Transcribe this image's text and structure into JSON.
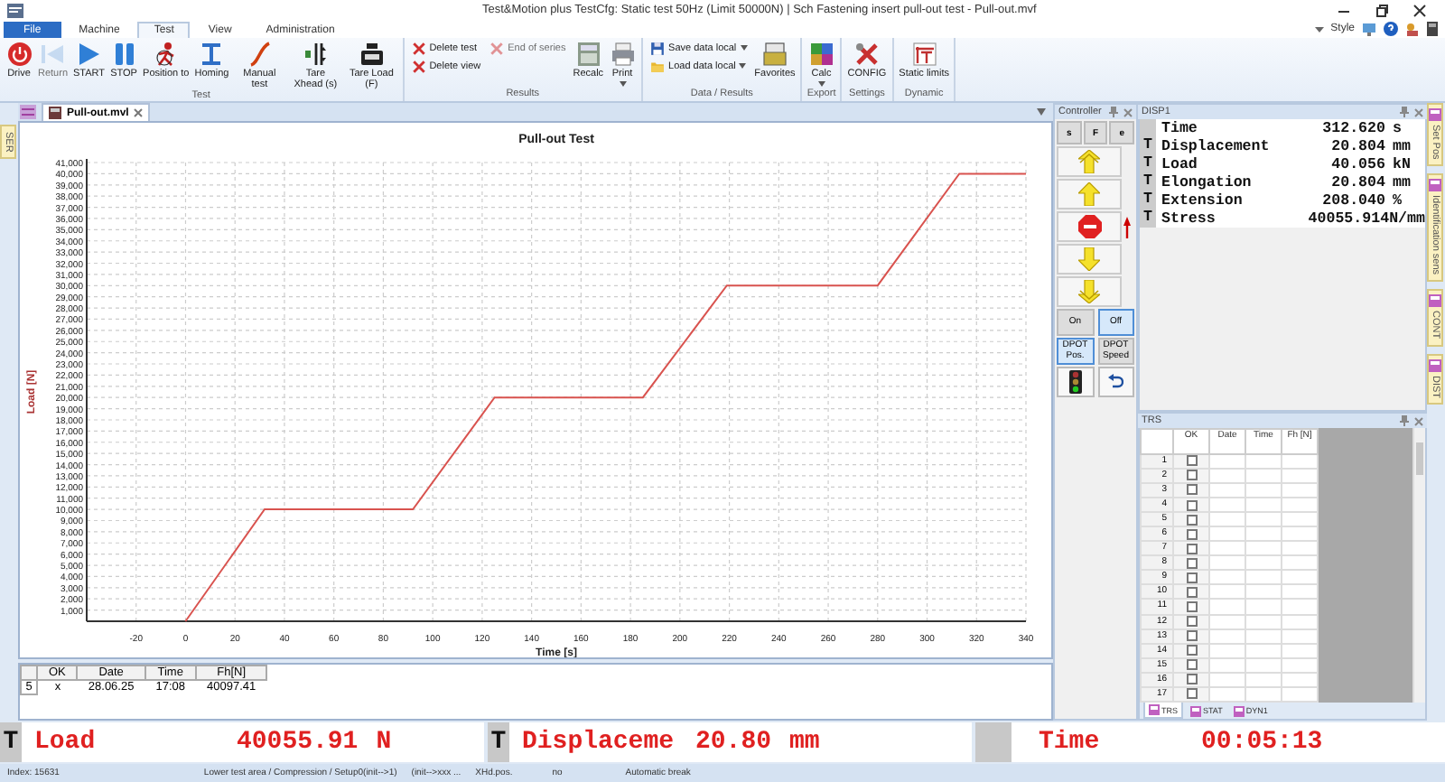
{
  "window": {
    "title": "Test&Motion plus   TestCfg: Static test 50Hz (Limit 50000N) | Sch Fastening insert pull-out test  - Pull-out.mvf"
  },
  "menu_tabs": [
    {
      "label": "File",
      "kind": "file",
      "selected": false
    },
    {
      "label": "Machine",
      "kind": "tab",
      "selected": false
    },
    {
      "label": "Test",
      "kind": "tab",
      "selected": true
    },
    {
      "label": "View",
      "kind": "tab",
      "selected": false
    },
    {
      "label": "Administration",
      "kind": "tab",
      "selected": false
    }
  ],
  "quick_access": {
    "style": "Style"
  },
  "ribbon": {
    "groups": [
      {
        "label": "Test",
        "items": [
          {
            "label": "Drive",
            "kind": "large",
            "disabled": false
          },
          {
            "label": "Return",
            "kind": "large",
            "disabled": true
          },
          {
            "label": "START",
            "kind": "large",
            "disabled": false
          },
          {
            "label": "STOP",
            "kind": "large",
            "disabled": false
          },
          {
            "label": "Position to",
            "kind": "large",
            "disabled": false
          },
          {
            "label": "Homing",
            "kind": "large",
            "disabled": false
          },
          {
            "label": "Manual test",
            "kind": "large",
            "disabled": false
          },
          {
            "label": "Tare Xhead (s)",
            "kind": "large",
            "disabled": false
          },
          {
            "label": "Tare Load (F)",
            "kind": "large",
            "disabled": false
          }
        ]
      },
      {
        "label": "Results",
        "items": [
          {
            "label": "Delete test",
            "kind": "small",
            "disabled": false
          },
          {
            "label": "Delete view",
            "kind": "small",
            "disabled": false
          },
          {
            "label": "End of series",
            "kind": "small",
            "disabled": true
          },
          {
            "label": "Recalc",
            "kind": "large",
            "disabled": false
          },
          {
            "label": "Print",
            "kind": "large",
            "disabled": false,
            "dropdown": true
          }
        ]
      },
      {
        "label": "Data / Results",
        "items": [
          {
            "label": "Save data local",
            "kind": "small",
            "disabled": false,
            "dropdown": true
          },
          {
            "label": "Load data local",
            "kind": "small",
            "disabled": false,
            "dropdown": true
          },
          {
            "label": "Favorites",
            "kind": "large",
            "disabled": false
          }
        ]
      },
      {
        "label": "Export",
        "items": [
          {
            "label": "Calc",
            "kind": "large",
            "disabled": false,
            "dropdown": true
          }
        ]
      },
      {
        "label": "Settings",
        "items": [
          {
            "label": "CONFIG",
            "kind": "large",
            "disabled": false
          }
        ]
      },
      {
        "label": "Dynamic",
        "items": [
          {
            "label": "Static limits",
            "kind": "large",
            "disabled": false
          }
        ]
      }
    ]
  },
  "doc_tabs": [
    {
      "label": "Pull-out.mvl",
      "selected": true
    }
  ],
  "left_side_tabs": [
    {
      "label": "SER"
    }
  ],
  "right_side_tabs": [
    {
      "label": "Set Pos"
    },
    {
      "label": "Identification sens"
    },
    {
      "label": "CONT"
    },
    {
      "label": "DIST"
    }
  ],
  "chart": {
    "chart_data": {
      "type": "line",
      "title": "Pull-out Test",
      "xlabel": "Time [s]",
      "ylabel": "Load [N]",
      "grid": true,
      "xlim": [
        -40,
        340
      ],
      "ylim": [
        0,
        41000
      ],
      "xticks": [
        -20,
        0,
        20,
        40,
        60,
        80,
        100,
        120,
        140,
        160,
        180,
        200,
        220,
        240,
        260,
        280,
        300,
        320,
        340
      ],
      "yticks": [
        {
          "value": 1000,
          "label": "1,000"
        },
        {
          "value": 2000,
          "label": "2,000"
        },
        {
          "value": 3000,
          "label": "3,000"
        },
        {
          "value": 4000,
          "label": "4,000"
        },
        {
          "value": 5000,
          "label": "5,000"
        },
        {
          "value": 6000,
          "label": "6,000"
        },
        {
          "value": 7000,
          "label": "7,000"
        },
        {
          "value": 8000,
          "label": "8,000"
        },
        {
          "value": 9000,
          "label": "9,000"
        },
        {
          "value": 10000,
          "label": "10,000"
        },
        {
          "value": 11000,
          "label": "11,000"
        },
        {
          "value": 12000,
          "label": "12,000"
        },
        {
          "value": 13000,
          "label": "13,000"
        },
        {
          "value": 14000,
          "label": "14,000"
        },
        {
          "value": 15000,
          "label": "15,000"
        },
        {
          "value": 16000,
          "label": "16,000"
        },
        {
          "value": 17000,
          "label": "17,000"
        },
        {
          "value": 18000,
          "label": "18,000"
        },
        {
          "value": 19000,
          "label": "19,000"
        },
        {
          "value": 20000,
          "label": "20,000"
        },
        {
          "value": 21000,
          "label": "21,000"
        },
        {
          "value": 22000,
          "label": "22,000"
        },
        {
          "value": 23000,
          "label": "23,000"
        },
        {
          "value": 24000,
          "label": "24,000"
        },
        {
          "value": 25000,
          "label": "25,000"
        },
        {
          "value": 26000,
          "label": "26,000"
        },
        {
          "value": 27000,
          "label": "27,000"
        },
        {
          "value": 28000,
          "label": "28,000"
        },
        {
          "value": 29000,
          "label": "29,000"
        },
        {
          "value": 30000,
          "label": "30,000"
        },
        {
          "value": 31000,
          "label": "31,000"
        },
        {
          "value": 32000,
          "label": "32,000"
        },
        {
          "value": 33000,
          "label": "33,000"
        },
        {
          "value": 34000,
          "label": "34,000"
        },
        {
          "value": 35000,
          "label": "35,000"
        },
        {
          "value": 36000,
          "label": "36,000"
        },
        {
          "value": 37000,
          "label": "37,000"
        },
        {
          "value": 38000,
          "label": "38,000"
        },
        {
          "value": 39000,
          "label": "39,000"
        },
        {
          "value": 40000,
          "label": "40,000"
        },
        {
          "value": 41000,
          "label": "41,000"
        }
      ],
      "x": [
        0,
        32,
        92,
        125,
        185,
        219,
        280,
        313,
        340
      ],
      "series": [
        {
          "color": "#d9534f",
          "values": [
            0,
            10000,
            10000,
            20000,
            20000,
            30000,
            30000,
            40000,
            40000
          ]
        }
      ]
    }
  },
  "results": {
    "columns": [
      "OK",
      "Date",
      "Time",
      "Fh[N]"
    ],
    "rows": [
      {
        "index": "5",
        "cells": [
          "x",
          "28.06.25",
          "17:08",
          "40097.41"
        ]
      }
    ]
  },
  "controller": {
    "title": "Controller",
    "modes": [
      "s",
      "F",
      "e"
    ],
    "jog": [
      {
        "kind": "fast-up"
      },
      {
        "kind": "up"
      },
      {
        "kind": "stop"
      },
      {
        "kind": "down"
      },
      {
        "kind": "fast-down"
      }
    ],
    "toggles": [
      {
        "label": "On",
        "selected": false
      },
      {
        "label": "Off",
        "selected": true
      }
    ],
    "dpot": [
      {
        "label": "DPOT Pos.",
        "selected": true
      },
      {
        "label": "DPOT Speed",
        "selected": false
      }
    ]
  },
  "disp1": {
    "title": "DISP1",
    "rows": [
      {
        "name": "Time",
        "value": "312.620",
        "unit": "s"
      },
      {
        "mark": "T",
        "name": "Displacement",
        "value": "20.804",
        "unit": "mm"
      },
      {
        "mark": "T",
        "name": "Load",
        "value": "40.056",
        "unit": "kN"
      },
      {
        "mark": "T",
        "name": "Elongation",
        "value": "20.804",
        "unit": "mm"
      },
      {
        "mark": "T",
        "name": "Extension",
        "value": "208.040",
        "unit": "%"
      },
      {
        "mark": "T",
        "name": "Stress",
        "value": "40055.914N/mm"
      }
    ]
  },
  "trs": {
    "title": "TRS",
    "columns": [
      "OK",
      "Date",
      "Time",
      "Fh [N]"
    ],
    "rows": [
      {
        "index": "1",
        "checked": false
      },
      {
        "index": "2",
        "checked": false
      },
      {
        "index": "3",
        "checked": false
      },
      {
        "index": "4",
        "checked": false
      },
      {
        "index": "5",
        "checked": false
      },
      {
        "index": "6",
        "checked": false
      },
      {
        "index": "7",
        "checked": false
      },
      {
        "index": "8",
        "checked": false
      },
      {
        "index": "9",
        "checked": false
      },
      {
        "index": "10",
        "checked": false
      },
      {
        "index": "11",
        "checked": false
      },
      {
        "index": "12",
        "checked": false
      },
      {
        "index": "13",
        "checked": false
      },
      {
        "index": "14",
        "checked": false
      },
      {
        "index": "15",
        "checked": false
      },
      {
        "index": "16",
        "checked": false
      },
      {
        "index": "17",
        "checked": false
      }
    ],
    "tabs": [
      {
        "label": "TRS",
        "selected": true
      },
      {
        "label": "STAT",
        "selected": false
      },
      {
        "label": "DYN1",
        "selected": false
      }
    ]
  },
  "display": [
    {
      "mark": "T",
      "name": "Load",
      "value": "40055.91",
      "unit": "N"
    },
    {
      "mark": "T",
      "name": "Displaceme",
      "value": "20.80",
      "unit": "mm"
    },
    {
      "name": "Time",
      "value": "00:05:13"
    }
  ],
  "status_bar": [
    "Index: 15631",
    "Lower test area / Compression / Setup0(init-->1)",
    "(init-->xxx ...",
    "XHd.pos.",
    "no",
    "Automatic break"
  ]
}
